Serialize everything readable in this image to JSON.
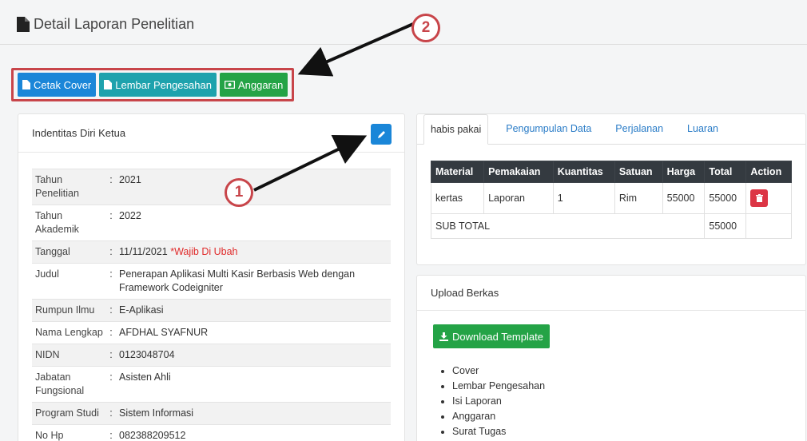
{
  "page": {
    "title": "Detail Laporan Penelitian"
  },
  "toolbar": {
    "cetak_cover": "Cetak Cover",
    "lembar_pengesahan": "Lembar Pengesahan",
    "anggaran": "Anggaran"
  },
  "callouts": {
    "one": "1",
    "two": "2"
  },
  "identity": {
    "header": "Indentitas Diri Ketua",
    "rows": [
      {
        "label": "Tahun Penelitian",
        "value": "2021"
      },
      {
        "label": "Tahun Akademik",
        "value": "2022"
      },
      {
        "label": "Tanggal",
        "value": "11/11/2021",
        "note": "*Wajib Di Ubah"
      },
      {
        "label": "Judul",
        "value": "Penerapan Aplikasi Multi Kasir Berbasis Web dengan Framework Codeigniter"
      },
      {
        "label": "Rumpun Ilmu",
        "value": "E-Aplikasi"
      },
      {
        "label": "Nama Lengkap",
        "value": "AFDHAL SYAFNUR"
      },
      {
        "label": "NIDN",
        "value": "0123048704"
      },
      {
        "label": "Jabatan Fungsional",
        "value": "Asisten Ahli"
      },
      {
        "label": "Program Studi",
        "value": "Sistem Informasi"
      },
      {
        "label": "No Hp",
        "value": "082388209512"
      }
    ]
  },
  "tabs": [
    "habis pakai",
    "Pengumpulan Data",
    "Perjalanan",
    "Luaran"
  ],
  "materials": {
    "headers": [
      "Material",
      "Pemakaian",
      "Kuantitas",
      "Satuan",
      "Harga",
      "Total",
      "Action"
    ],
    "rows": [
      {
        "material": "kertas",
        "pemakaian": "Laporan",
        "kuantitas": "1",
        "satuan": "Rim",
        "harga": "55000",
        "total": "55000"
      }
    ],
    "subtotal_label": "SUB TOTAL",
    "subtotal_value": "55000"
  },
  "upload": {
    "header": "Upload Berkas",
    "download_label": "Download Template",
    "files": [
      "Cover",
      "Lembar Pengesahan",
      "Isi Laporan",
      "Anggaran",
      "Surat Tugas"
    ]
  },
  "colors": {
    "primary": "#1a86d8",
    "teal": "#1ea2ad",
    "success": "#24a346",
    "danger": "#dc3545",
    "callout": "#c8454a",
    "table_head": "#343a40"
  },
  "icons": [
    "file-icon",
    "money-icon",
    "pencil-icon",
    "trash-icon",
    "download-icon"
  ]
}
